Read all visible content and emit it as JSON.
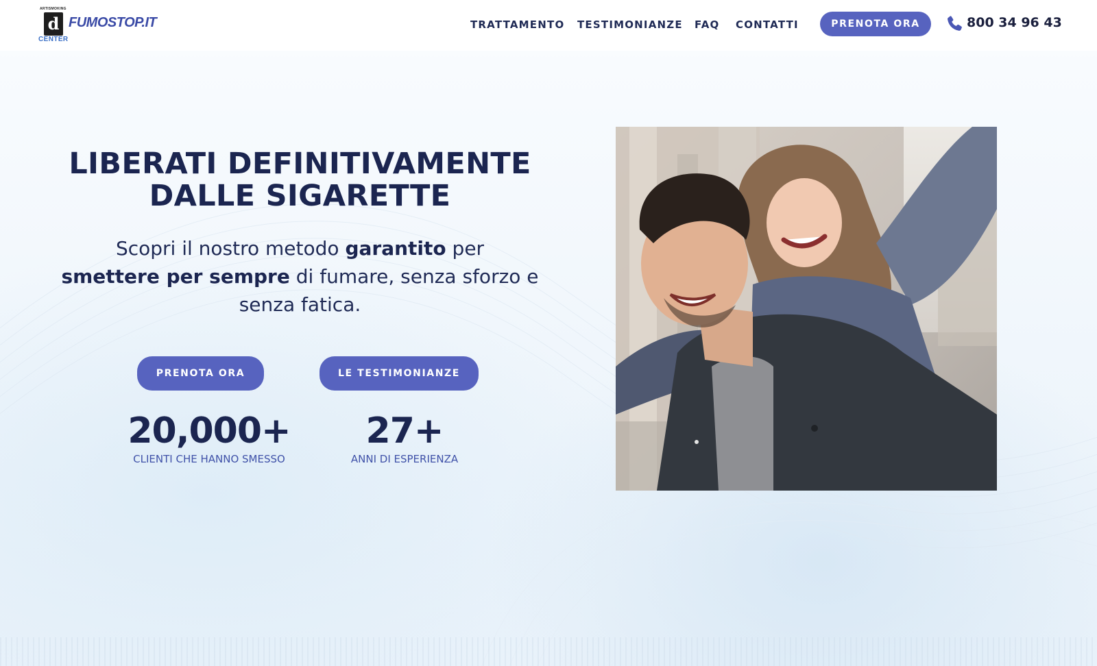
{
  "header": {
    "logo": {
      "top_text": "ARTISMOKING",
      "mark": "d",
      "wordmark": "FUMOSTOP.IT",
      "sub_text": "CENTER"
    },
    "nav": [
      "TRATTAMENTO",
      "TESTIMONIANZE",
      "FAQ",
      "CONTATTI"
    ],
    "cta_label": "PRENOTA ORA",
    "phone": "800 34 96 43"
  },
  "hero": {
    "title_line1": "LIBERATI DEFINITIVAMENTE",
    "title_line2": "DALLE SIGARETTE",
    "subtitle": {
      "p1": "Scopri il nostro metodo ",
      "b1": "garantito",
      "p2": " per ",
      "b2": "smettere per sempre",
      "p3": " di fumare, senza sforzo e senza fatica."
    },
    "buttons": {
      "primary": "PRENOTA ORA",
      "secondary": "LE TESTIMONIANZE"
    },
    "stats": [
      {
        "value": "20,000+",
        "label": "CLIENTI CHE HANNO SMESSO"
      },
      {
        "value": "27+",
        "label": "ANNI DI ESPERIENZA"
      }
    ]
  },
  "colors": {
    "accent": "#5763bf",
    "heading": "#1b2550",
    "stat_label": "#3f51a8",
    "phone_icon": "#4a57b5"
  },
  "icons": {
    "phone": "phone-icon"
  }
}
